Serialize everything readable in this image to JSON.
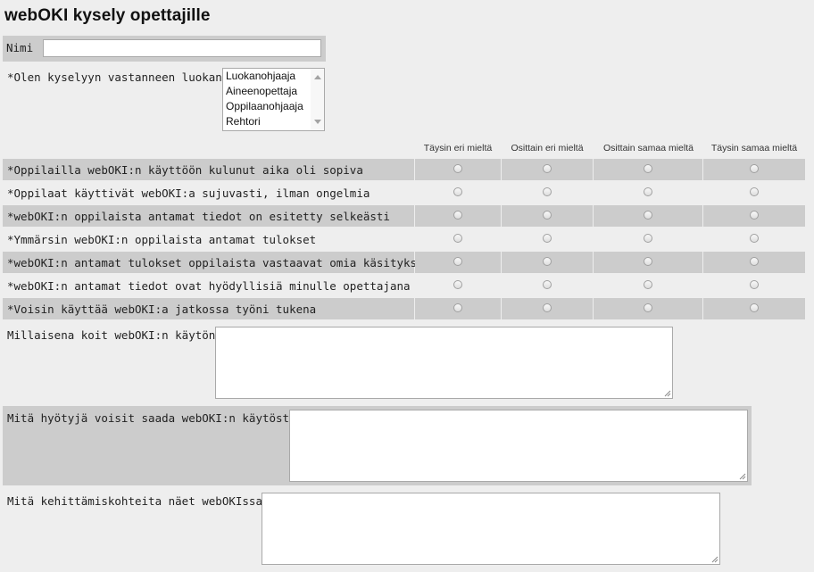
{
  "title": "webOKI kysely opettajille",
  "name_field": {
    "label": "Nimi",
    "value": ""
  },
  "role": {
    "label": "*Olen kyselyyn vastanneen luokan",
    "options": [
      "Luokanohjaaja",
      "Aineenopettaja",
      "Oppilaanohjaaja",
      "Rehtori"
    ]
  },
  "scale": {
    "columns": [
      "Täysin eri mieltä",
      "Osittain eri mieltä",
      "Osittain samaa mieltä",
      "Täysin samaa mieltä"
    ]
  },
  "questions": [
    "*Oppilailla webOKI:n käyttöön kulunut aika oli sopiva",
    "*Oppilaat käyttivät webOKI:a sujuvasti, ilman ongelmia",
    "*webOKI:n oppilaista antamat tiedot on esitetty selkeästi",
    "*Ymmärsin webOKI:n oppilaista antamat tulokset",
    "*webOKI:n antamat tulokset oppilaista vastaavat omia käsityksiäni",
    "*webOKI:n antamat tiedot ovat hyödyllisiä minulle opettajana",
    "*Voisin käyttää webOKI:a jatkossa työni tukena"
  ],
  "open_questions": [
    {
      "label": "Millaisena koit webOKI:n käytön?",
      "value": ""
    },
    {
      "label": "Mitä hyötyjä voisit saada webOKI:n käytöstä?",
      "value": ""
    },
    {
      "label": "Mitä kehittämiskohteita näet webOKIssa?",
      "value": ""
    }
  ],
  "colors": {
    "page_bg": "#eeeeee",
    "row_shade": "#cccccc",
    "field_bg": "#ffffff",
    "field_border": "#a9a9a9"
  }
}
